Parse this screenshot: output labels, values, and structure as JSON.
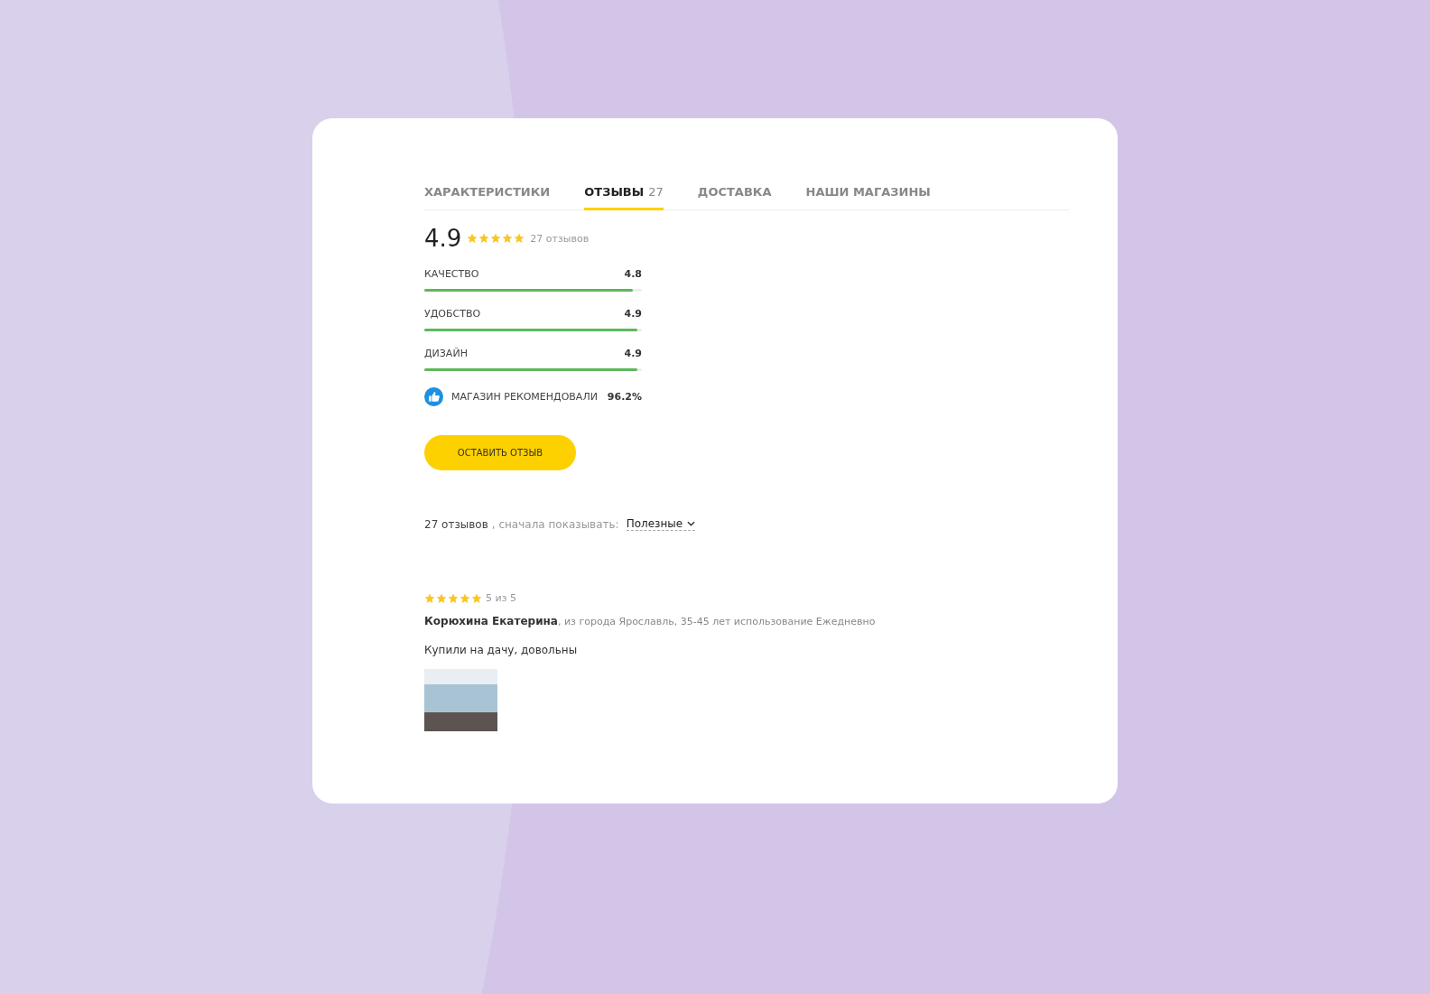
{
  "tabs": [
    {
      "label": "ХАРАКТЕРИСТИКИ",
      "selected": false
    },
    {
      "label": "ОТЗЫВЫ",
      "count": "27",
      "selected": true
    },
    {
      "label": "ДОСТАВКА",
      "selected": false
    },
    {
      "label": "НАШИ МАГАЗИНЫ",
      "selected": false
    }
  ],
  "summary": {
    "score": "4.9",
    "stars": 5,
    "count": "27 отзывов"
  },
  "criteria": [
    {
      "name": "КАЧЕСТВО",
      "value": "4.8",
      "level": 0.96
    },
    {
      "name": "УДОБСТВО",
      "value": "4.9",
      "level": 0.98
    },
    {
      "name": "ДИЗАЙН",
      "value": "4.9",
      "level": 0.98
    }
  ],
  "recommend": {
    "label": "МАГАЗИН РЕКОМЕНДОВАЛИ",
    "value": "96.2%"
  },
  "review_button": "ОСТАВИТЬ ОТЗЫВ",
  "sort": {
    "count": "27 отзывов",
    "label": ", сначала показывать:",
    "value": "Полезные"
  },
  "reviews": [
    {
      "stars": 5,
      "score": "5 из 5",
      "author": "Корюхина Екатерина",
      "meta": ", из города Ярославль, 35-45 лет использование Ежедневно",
      "text": "Купили на дачу, довольны"
    }
  ]
}
